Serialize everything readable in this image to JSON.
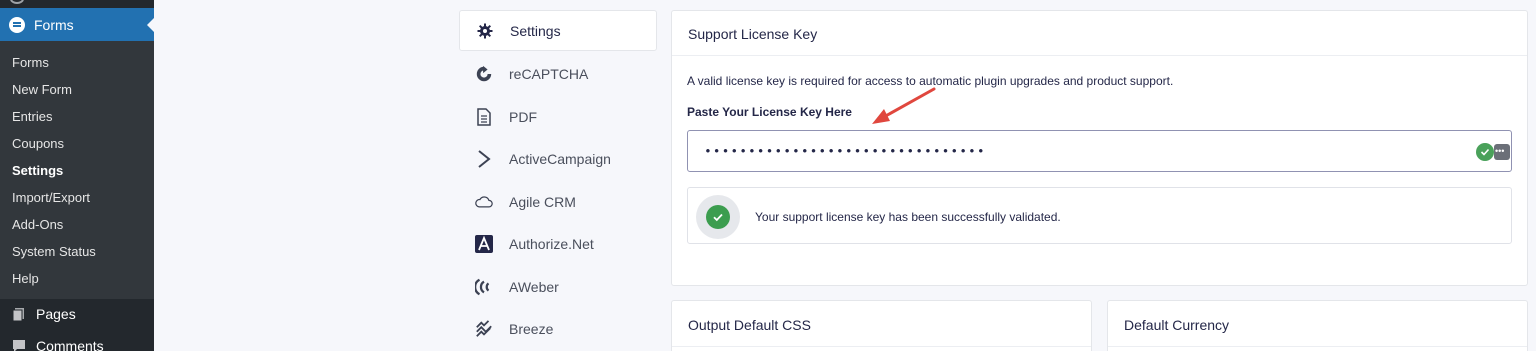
{
  "wp_menu": {
    "parent_label": "Forms",
    "submenu": [
      {
        "label": "Forms",
        "current": false
      },
      {
        "label": "New Form",
        "current": false
      },
      {
        "label": "Entries",
        "current": false
      },
      {
        "label": "Coupons",
        "current": false
      },
      {
        "label": "Settings",
        "current": true
      },
      {
        "label": "Import/Export",
        "current": false
      },
      {
        "label": "Add-Ons",
        "current": false
      },
      {
        "label": "System Status",
        "current": false
      },
      {
        "label": "Help",
        "current": false
      }
    ],
    "pages_label": "Pages",
    "comments_label": "Comments"
  },
  "settings_nav": [
    {
      "label": "Settings",
      "icon": "gear-icon",
      "active": true
    },
    {
      "label": "reCAPTCHA",
      "icon": "recaptcha-icon",
      "active": false
    },
    {
      "label": "PDF",
      "icon": "pdf-document-icon",
      "active": false
    },
    {
      "label": "ActiveCampaign",
      "icon": "activecampaign-chevron-icon",
      "active": false
    },
    {
      "label": "Agile CRM",
      "icon": "cloud-icon",
      "active": false
    },
    {
      "label": "Authorize.Net",
      "icon": "authorize-net-icon",
      "active": false
    },
    {
      "label": "AWeber",
      "icon": "aweber-icon",
      "active": false
    },
    {
      "label": "Breeze",
      "icon": "breeze-icon",
      "active": false
    }
  ],
  "license_panel": {
    "title": "Support License Key",
    "description": "A valid license key is required for access to automatic plugin upgrades and product support.",
    "field_label": "Paste Your License Key Here",
    "field_value": "••••••••••••••••••••••••••••••••",
    "success_message": "Your support license key has been successfully validated."
  },
  "css_panel": {
    "title": "Output Default CSS"
  },
  "currency_panel": {
    "title": "Default Currency"
  },
  "colors": {
    "wp_sidebar": "#23282d",
    "wp_submenu": "#32373c",
    "wp_accent": "#2271b1",
    "success_green": "#3c9d4f",
    "annotation_red": "#e0473e"
  }
}
